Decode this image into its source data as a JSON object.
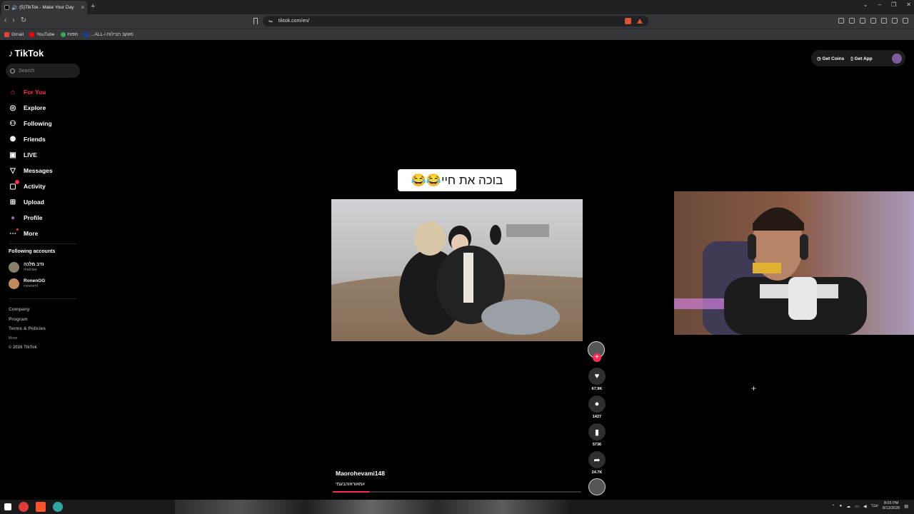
{
  "browser": {
    "tab_title": "(5)TikTok - Make Your Day",
    "url": "tiktok.com/en/",
    "bookmarks": [
      {
        "label": "Gmail",
        "color": "#ea4335"
      },
      {
        "label": "YouTube",
        "color": "#ff0000"
      },
      {
        "label": "מפות",
        "color": "#34a853"
      },
      {
        "label": "...ALL-i מעקב חבילות",
        "color": "#1a3f8f"
      }
    ]
  },
  "sidebar": {
    "logo": "TikTok",
    "search_placeholder": "Search",
    "items": [
      {
        "label": "For You",
        "icon": "home-icon",
        "glyph": "⌂"
      },
      {
        "label": "Explore",
        "icon": "compass-icon",
        "glyph": "◎"
      },
      {
        "label": "Following",
        "icon": "user-plus-icon",
        "glyph": "⚇"
      },
      {
        "label": "Friends",
        "icon": "friends-icon",
        "glyph": "⚉"
      },
      {
        "label": "LIVE",
        "icon": "live-tv-icon",
        "glyph": "▣"
      },
      {
        "label": "Messages",
        "icon": "send-icon",
        "glyph": "▽"
      },
      {
        "label": "Activity",
        "icon": "inbox-icon",
        "glyph": "▢"
      },
      {
        "label": "Upload",
        "icon": "upload-icon",
        "glyph": "⊞"
      },
      {
        "label": "Profile",
        "icon": "profile-avatar-icon",
        "glyph": "●"
      },
      {
        "label": "More",
        "icon": "more-dots-icon",
        "glyph": "⋯"
      }
    ],
    "following_title": "Following accounts",
    "accounts": [
      {
        "name": "נדב מלכה",
        "handle": "malcaw"
      },
      {
        "name": "RonenGG",
        "handle": "ronenml"
      }
    ],
    "footer": {
      "company": "Company",
      "program": "Program",
      "terms": "Terms & Policies",
      "more": "More",
      "copyright": "© 2026 TikTok"
    }
  },
  "header": {
    "get_coins": "Get Coins",
    "get_app": "Get App"
  },
  "video": {
    "caption": "בוכה את חיי😂😂",
    "author": "Maorohevami148",
    "hashtag": "#מאוראוהבעמי",
    "progress": 0.15,
    "likes": "67.9K",
    "comments": "1427",
    "saves": "5736",
    "shares": "24.7K"
  },
  "taskbar": {
    "lang": "עבר",
    "time": "8:03 PM",
    "date": "8/13/2026"
  },
  "colors": {
    "accent": "#fe2c55"
  }
}
